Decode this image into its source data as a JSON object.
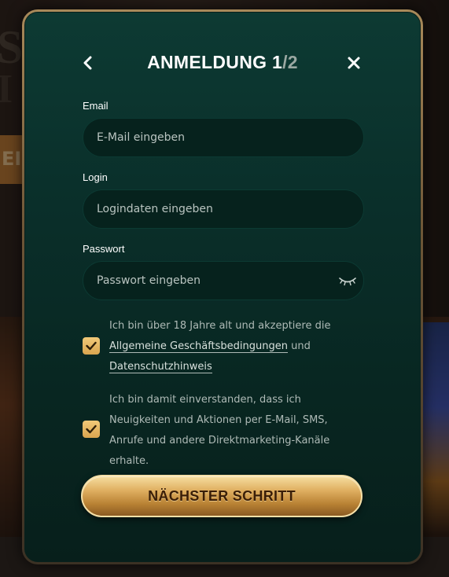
{
  "modal": {
    "title_main": "ANMELDUNG 1",
    "title_total": "/2"
  },
  "form": {
    "email_label": "Email",
    "email_placeholder": "E-Mail eingeben",
    "login_label": "Login",
    "login_placeholder": "Logindaten eingeben",
    "password_label": "Passwort",
    "password_placeholder": "Passwort eingeben"
  },
  "consents": [
    {
      "checked": true,
      "text_before": "Ich bin über 18 Jahre alt und akzeptiere die ",
      "link1": "Allgemeine Geschäftsbedingungen",
      "text_mid": " und ",
      "link2": "Datenschutzhinweis"
    },
    {
      "checked": true,
      "text": "Ich bin damit einverstanden, dass ich Neuigkeiten und Aktionen per E-Mail, SMS, Anrufe und andere Direktmarketing-Kanäle erhalte."
    }
  ],
  "actions": {
    "next_label": "NÄCHSTER SCHRITT"
  },
  "icons": {
    "back": "chevron-left-icon",
    "close": "close-icon",
    "eye": "eye-closed-icon",
    "check": "checkmark-icon"
  },
  "colors": {
    "modal_bg": "#0a2f2a",
    "accent_gold": "#e0b062",
    "checkbox": "#f2c978"
  }
}
